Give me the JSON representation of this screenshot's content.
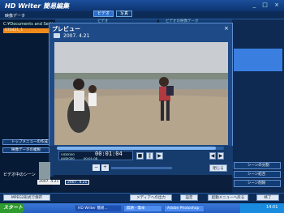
{
  "app": {
    "title": "HD Writer 簡易編集"
  },
  "tabs": {
    "video": "ビデオ",
    "photo": "写真"
  },
  "left_panel": {
    "header": "映像データ",
    "path": "C:¥Documents and Setti",
    "selected_folder": "070421_1",
    "item": "070421"
  },
  "list_headers": {
    "col1": "ビデオ",
    "col2": "ビデオの映像データ"
  },
  "preview": {
    "title": "プレビュー",
    "date": "2007. 4.21",
    "close": "×",
    "timecode": "00:01:04",
    "sub_timecode": "00:01:08",
    "info_video": "VIDEO",
    "info_audio": "AUDIO",
    "info_v": "00",
    "info_a": "00",
    "close_button": "閉じる"
  },
  "left_buttons": {
    "top_menu": "トップメニューの作成",
    "copy": "映像データの複製",
    "scene_label": "ビデオ中のシーン"
  },
  "right_buttons": {
    "split": "シーンの分割",
    "to_scene": "シーン結合",
    "delete": "シーン削除"
  },
  "thumbs": {
    "date1": "2007. 4.21",
    "date2": "2007. 4.21"
  },
  "bottom": {
    "mpeg": "MPEG2形式で保存",
    "media": "メディアへの出力",
    "settings": "設定",
    "menu": "起動メニューへ戻る",
    "exit": "終了"
  },
  "taskbar": {
    "start": "スタート",
    "task1": "HD Writer 簡易...",
    "task2": "無題 - 電卓",
    "task3": "Adobe Photoshop",
    "time": "14:01"
  }
}
